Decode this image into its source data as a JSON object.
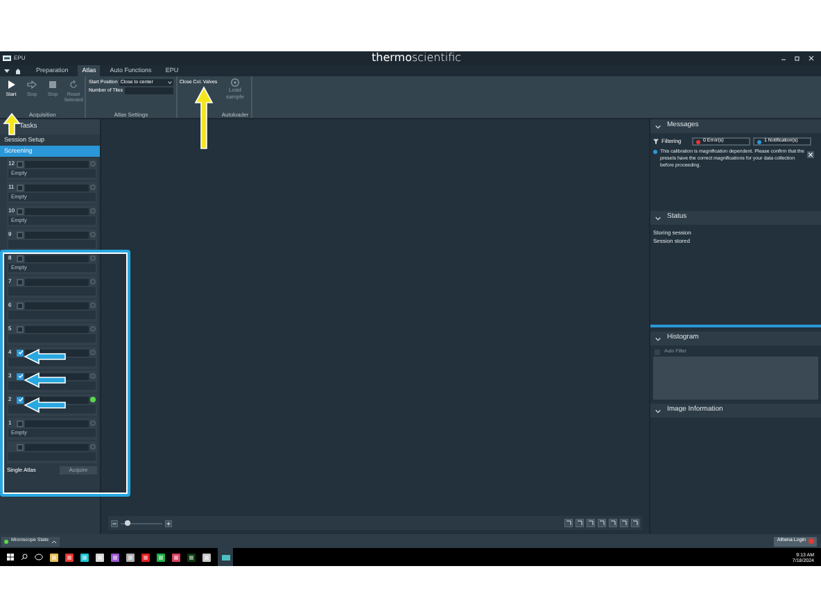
{
  "window": {
    "title": "EPU",
    "brand": "**thermo**scientific"
  },
  "tabs": [
    {
      "label": "Preparation",
      "selected": false
    },
    {
      "label": "Atlas",
      "selected": true
    },
    {
      "label": "Auto Functions",
      "selected": false
    },
    {
      "label": "EPU",
      "selected": false
    }
  ],
  "ribbon": {
    "acquisition": {
      "label": "Acquisition",
      "buttons": [
        {
          "label": "Start",
          "disabled": false
        },
        {
          "label": "Stop",
          "disabled": true
        },
        {
          "label": "Stop",
          "disabled": true
        },
        {
          "label": "Reset Selected",
          "disabled": true
        }
      ]
    },
    "atlas_settings": {
      "label": "Atlas Settings",
      "start_position": {
        "label": "Start Position",
        "value": "Close to center"
      },
      "number_of_tiles": {
        "label": "Number of Tiles"
      }
    },
    "close_valves": {
      "label": "Close Col. Valves"
    },
    "autoloader": {
      "label": "Autoloader",
      "button": {
        "label": "Load sample",
        "disabled": true
      }
    }
  },
  "tasks": {
    "title": "Tasks",
    "items": [
      {
        "label": "Session Setup",
        "selected": false
      },
      {
        "label": "Screening",
        "selected": true
      }
    ],
    "slots": [
      {
        "number": "12",
        "checked": false,
        "active": false,
        "status": "Empty"
      },
      {
        "number": "11",
        "checked": false,
        "active": false,
        "status": "Empty"
      },
      {
        "number": "10",
        "checked": false,
        "active": false,
        "status": "Empty"
      },
      {
        "number": "9",
        "checked": false,
        "active": false
      },
      {
        "number": "8",
        "checked": false,
        "active": false,
        "status": "Empty"
      },
      {
        "number": "7",
        "checked": false,
        "active": false
      },
      {
        "number": "6",
        "checked": false,
        "active": false
      },
      {
        "number": "5",
        "checked": false,
        "active": false
      },
      {
        "number": "4",
        "checked": true,
        "active": false
      },
      {
        "number": "3",
        "checked": true,
        "active": false
      },
      {
        "number": "2",
        "checked": true,
        "active": true
      },
      {
        "number": "1",
        "checked": false,
        "active": false,
        "status": "Empty"
      },
      {
        "checked": false,
        "active": false
      }
    ],
    "mode": "Single Atlas",
    "acquire": "Acquire"
  },
  "messages": {
    "title": "Messages",
    "expanded": true,
    "filter_label": "Filtering",
    "errors": "0 Error(s)",
    "notifications": "1 Notification(s)",
    "text": "This calibration is magnification dependent. Please confirm that the presets have the correct magnifications for your data collection before proceeding."
  },
  "status": {
    "title": "Status",
    "expanded": true,
    "lines": [
      "Storing session",
      "Session stored"
    ]
  },
  "histogram": {
    "title": "Histogram",
    "expanded": true,
    "auto_filter": {
      "label": "Auto Filter",
      "checked": false
    }
  },
  "image_information": {
    "title": "Image Information",
    "expanded": true
  },
  "viewer": {
    "zoom": {
      "level": 0.1
    }
  },
  "status_bar": {
    "microscope_state": "Microscope State",
    "login": "Athena Login"
  },
  "taskbar": {
    "time": "9:13 AM",
    "date": "7/18/2024"
  }
}
